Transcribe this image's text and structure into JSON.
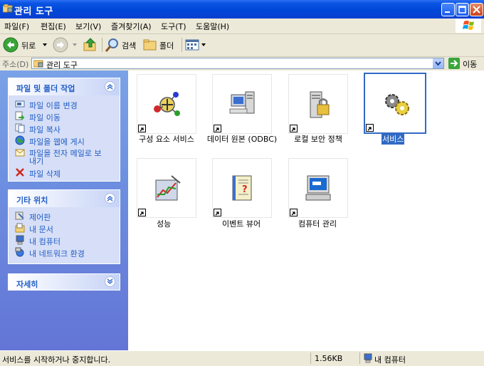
{
  "window": {
    "title": "관리 도구"
  },
  "menu": [
    "파일(F)",
    "편집(E)",
    "보기(V)",
    "즐겨찾기(A)",
    "도구(T)",
    "도움말(H)"
  ],
  "toolbar": {
    "back_label": "뒤로",
    "search_label": "검색",
    "folders_label": "폴더"
  },
  "address": {
    "label": "주소(D)",
    "value": "관리 도구",
    "go_label": "이동"
  },
  "tasks": {
    "file_folder": {
      "title": "파일 및 폴더 작업",
      "items": [
        "파일 이름 변경",
        "파일 이동",
        "파일 복사",
        "파일을 웹에 게시",
        "파일을 전자 메일로 보",
        "내기",
        "파일 삭제"
      ]
    },
    "other_places": {
      "title": "기타 위치",
      "items": [
        "제어판",
        "내 문서",
        "내 컴퓨터",
        "내 네트워크 환경"
      ]
    },
    "details": {
      "title": "자세히"
    }
  },
  "files": [
    {
      "label": "구성 요소 서비스",
      "icon": "component-services-icon"
    },
    {
      "label": "데이터 원본 (ODBC)",
      "icon": "odbc-icon"
    },
    {
      "label": "로컬 보안 정책",
      "icon": "local-security-icon"
    },
    {
      "label": "서비스",
      "icon": "services-icon",
      "selected": true
    },
    {
      "label": "성능",
      "icon": "performance-icon"
    },
    {
      "label": "이벤트 뷰어",
      "icon": "event-viewer-icon"
    },
    {
      "label": "컴퓨터 관리",
      "icon": "computer-management-icon"
    }
  ],
  "status": {
    "message": "서비스를 시작하거나 중지합니다.",
    "size": "1.56KB",
    "zone": "내 컴퓨터"
  }
}
